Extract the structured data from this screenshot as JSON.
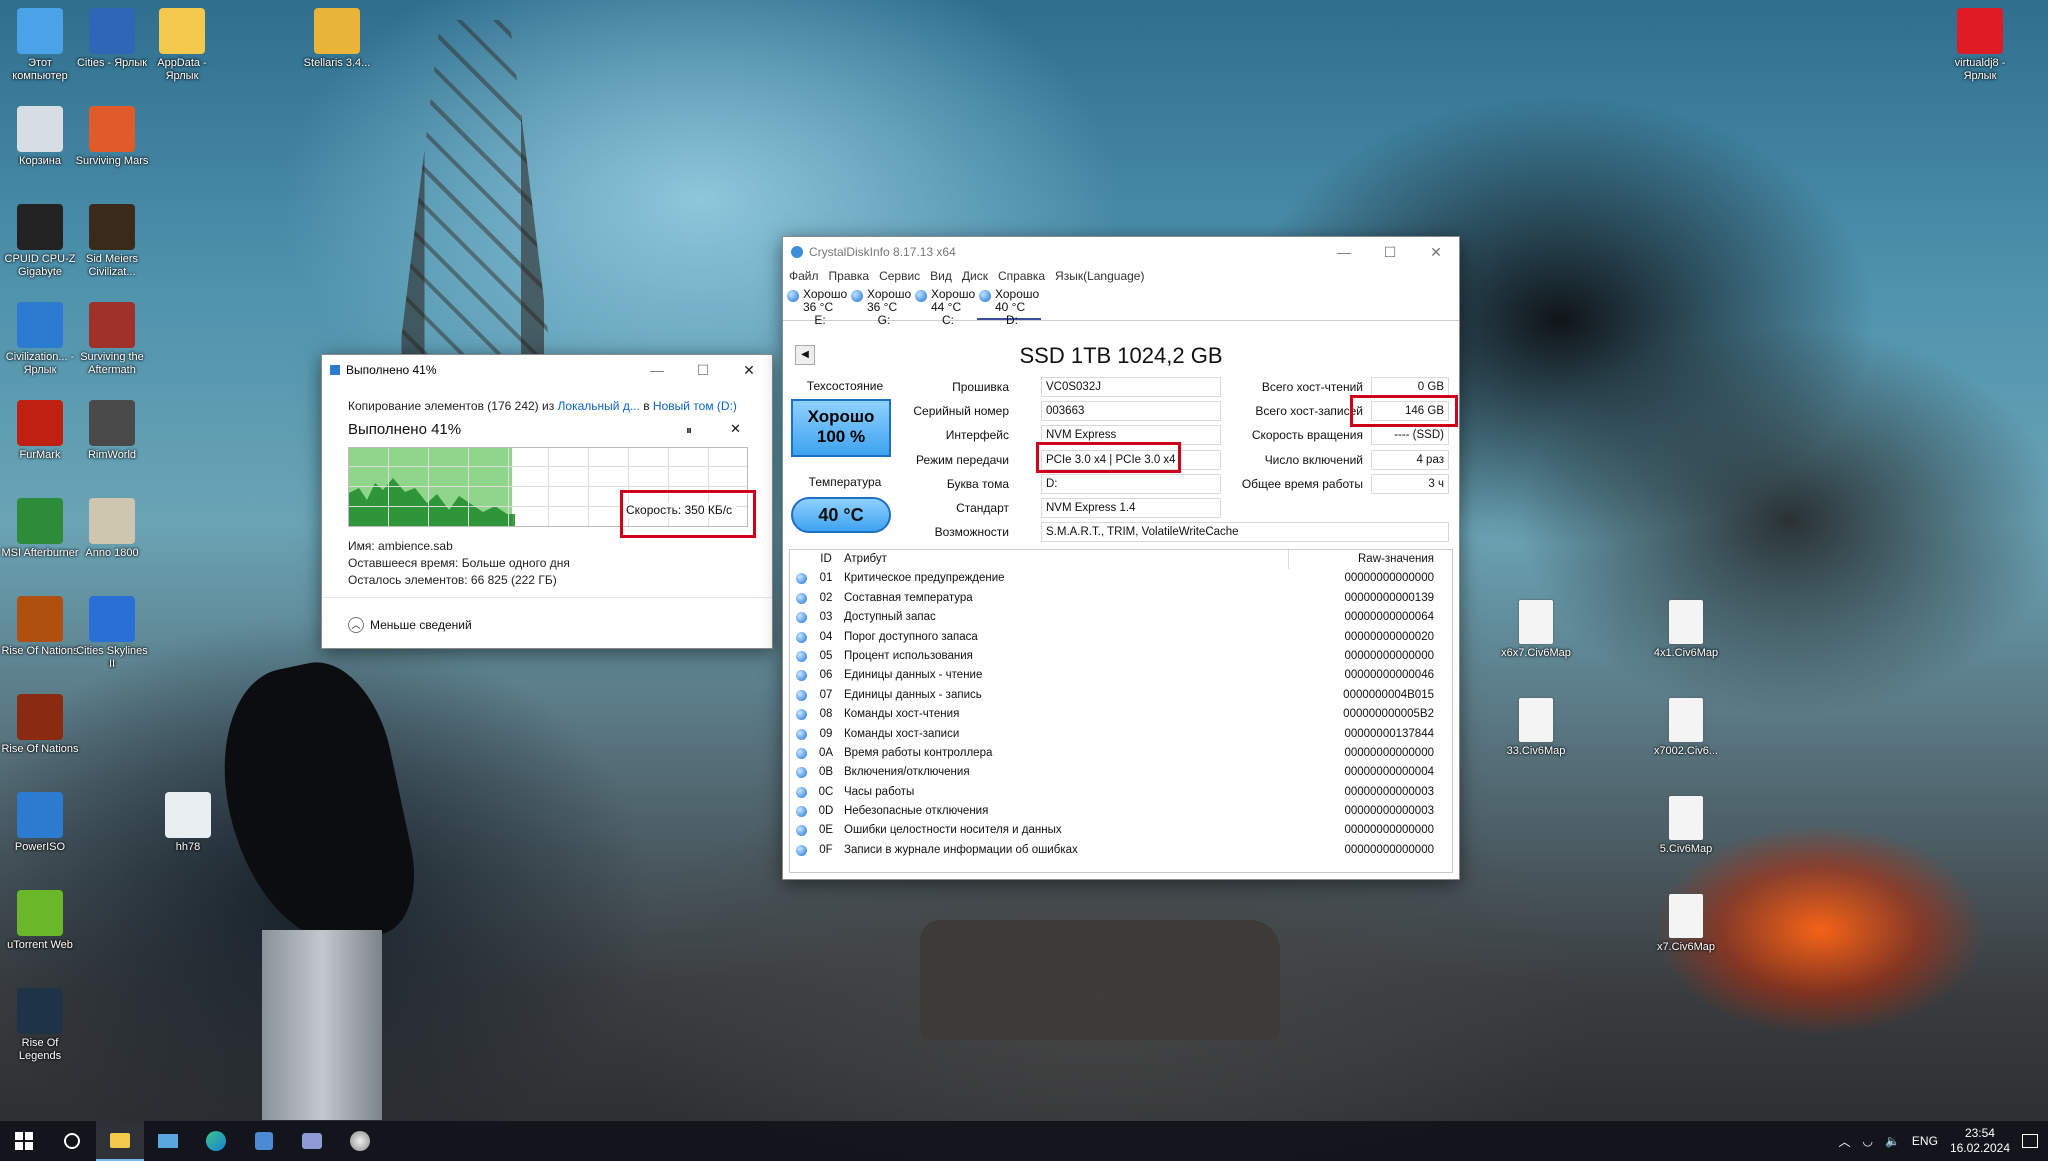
{
  "desktop": {
    "icons": [
      {
        "label": "Этот компьютер"
      },
      {
        "label": "Cities - Ярлык"
      },
      {
        "label": "AppData - Ярлык"
      },
      {
        "label": "Stellaris 3.4..."
      },
      {
        "label": "Корзина"
      },
      {
        "label": "Surviving Mars"
      },
      {
        "label": "CPUID CPU-Z Gigabyte"
      },
      {
        "label": "Sid Meiers Civilizat..."
      },
      {
        "label": "Civilization... - Ярлык"
      },
      {
        "label": "Surviving the Aftermath"
      },
      {
        "label": "FurMark"
      },
      {
        "label": "RimWorld"
      },
      {
        "label": "MSI Afterburner"
      },
      {
        "label": "Anno 1800"
      },
      {
        "label": "Rise Of Nations"
      },
      {
        "label": "Cities Skylines II"
      },
      {
        "label": "Rise Of Nations"
      },
      {
        "label": "PowerISO"
      },
      {
        "label": "hh78"
      },
      {
        "label": "uTorrent Web"
      },
      {
        "label": "Rise Of Legends"
      },
      {
        "label": "virtualdj8 - Ярлык"
      },
      {
        "label": "x6x7.Civ6Map"
      },
      {
        "label": "4x1.Civ6Map"
      },
      {
        "label": "33.Civ6Map"
      },
      {
        "label": "x7002.Civ6..."
      },
      {
        "label": "5.Civ6Map"
      },
      {
        "label": "x7.Civ6Map"
      }
    ]
  },
  "copy_window": {
    "title": "Выполнено 41%",
    "line1_prefix": "Копирование элементов (176 242) из",
    "source": "Локальный д...",
    "to": "в",
    "dest": "Новый том (D:)",
    "progress_title": "Выполнено 41%",
    "progress": 0.41,
    "speed": "Скорость: 350 КБ/с",
    "name": "Имя: ambience.sab",
    "time_left": "Оставшееся время: Больше одного дня",
    "items_left": "Осталось элементов: 66 825 (222 ГБ)",
    "less_details": "Меньше сведений",
    "pause_glyph": "⏸",
    "close_glyph": "✕"
  },
  "cdi": {
    "title": "CrystalDiskInfo 8.17.13 x64",
    "menu": [
      "Файл",
      "Правка",
      "Сервис",
      "Вид",
      "Диск",
      "Справка",
      "Язык(Language)"
    ],
    "drives": [
      {
        "status": "Хорошо",
        "temp": "36 °C",
        "letter": "E:"
      },
      {
        "status": "Хорошо",
        "temp": "36 °C",
        "letter": "G:"
      },
      {
        "status": "Хорошо",
        "temp": "44 °C",
        "letter": "C:"
      },
      {
        "status": "Хорошо",
        "temp": "40 °C",
        "letter": "D:"
      }
    ],
    "disk_title": "SSD 1TB 1024,2 GB",
    "health_label": "Техсостояние",
    "health_status": "Хорошо",
    "health_pct": "100 %",
    "temp_label": "Температура",
    "temp_value": "40 °C",
    "fields_left": [
      {
        "label": "Прошивка",
        "value": "VC0S032J"
      },
      {
        "label": "Серийный номер",
        "value": "003663"
      },
      {
        "label": "Интерфейс",
        "value": "NVM Express"
      },
      {
        "label": "Режим передачи",
        "value": "PCIe 3.0 x4 | PCIe 3.0 x4"
      },
      {
        "label": "Буква тома",
        "value": "D:"
      },
      {
        "label": "Стандарт",
        "value": "NVM Express 1.4"
      },
      {
        "label": "Возможности",
        "value": "S.M.A.R.T., TRIM, VolatileWriteCache"
      }
    ],
    "fields_right": [
      {
        "label": "Всего хост-чтений",
        "value": "0 GB"
      },
      {
        "label": "Всего хост-записей",
        "value": "146 GB"
      },
      {
        "label": "Скорость вращения",
        "value": "---- (SSD)"
      },
      {
        "label": "Число включений",
        "value": "4 раз"
      },
      {
        "label": "Общее время работы",
        "value": "3 ч"
      }
    ],
    "smart_headers": {
      "id": "ID",
      "attr": "Атрибут",
      "raw": "Raw-значения"
    },
    "smart": [
      {
        "id": "01",
        "attr": "Критическое предупреждение",
        "raw": "00000000000000"
      },
      {
        "id": "02",
        "attr": "Составная температура",
        "raw": "00000000000139"
      },
      {
        "id": "03",
        "attr": "Доступный запас",
        "raw": "00000000000064"
      },
      {
        "id": "04",
        "attr": "Порог доступного запаса",
        "raw": "00000000000020"
      },
      {
        "id": "05",
        "attr": "Процент использования",
        "raw": "00000000000000"
      },
      {
        "id": "06",
        "attr": "Единицы данных - чтение",
        "raw": "00000000000046"
      },
      {
        "id": "07",
        "attr": "Единицы данных - запись",
        "raw": "0000000004B015"
      },
      {
        "id": "08",
        "attr": "Команды хост-чтения",
        "raw": "000000000005B2"
      },
      {
        "id": "09",
        "attr": "Команды хост-записи",
        "raw": "00000000137844"
      },
      {
        "id": "0A",
        "attr": "Время работы контроллера",
        "raw": "00000000000000"
      },
      {
        "id": "0B",
        "attr": "Включения/отключения",
        "raw": "00000000000004"
      },
      {
        "id": "0C",
        "attr": "Часы работы",
        "raw": "00000000000003"
      },
      {
        "id": "0D",
        "attr": "Небезопасные отключения",
        "raw": "00000000000003"
      },
      {
        "id": "0E",
        "attr": "Ошибки целостности носителя и данных",
        "raw": "00000000000000"
      },
      {
        "id": "0F",
        "attr": "Записи в журнале информации об ошибках",
        "raw": "00000000000000"
      }
    ]
  },
  "taskbar": {
    "lang": "ENG",
    "time": "23:54",
    "date": "16.02.2024"
  }
}
